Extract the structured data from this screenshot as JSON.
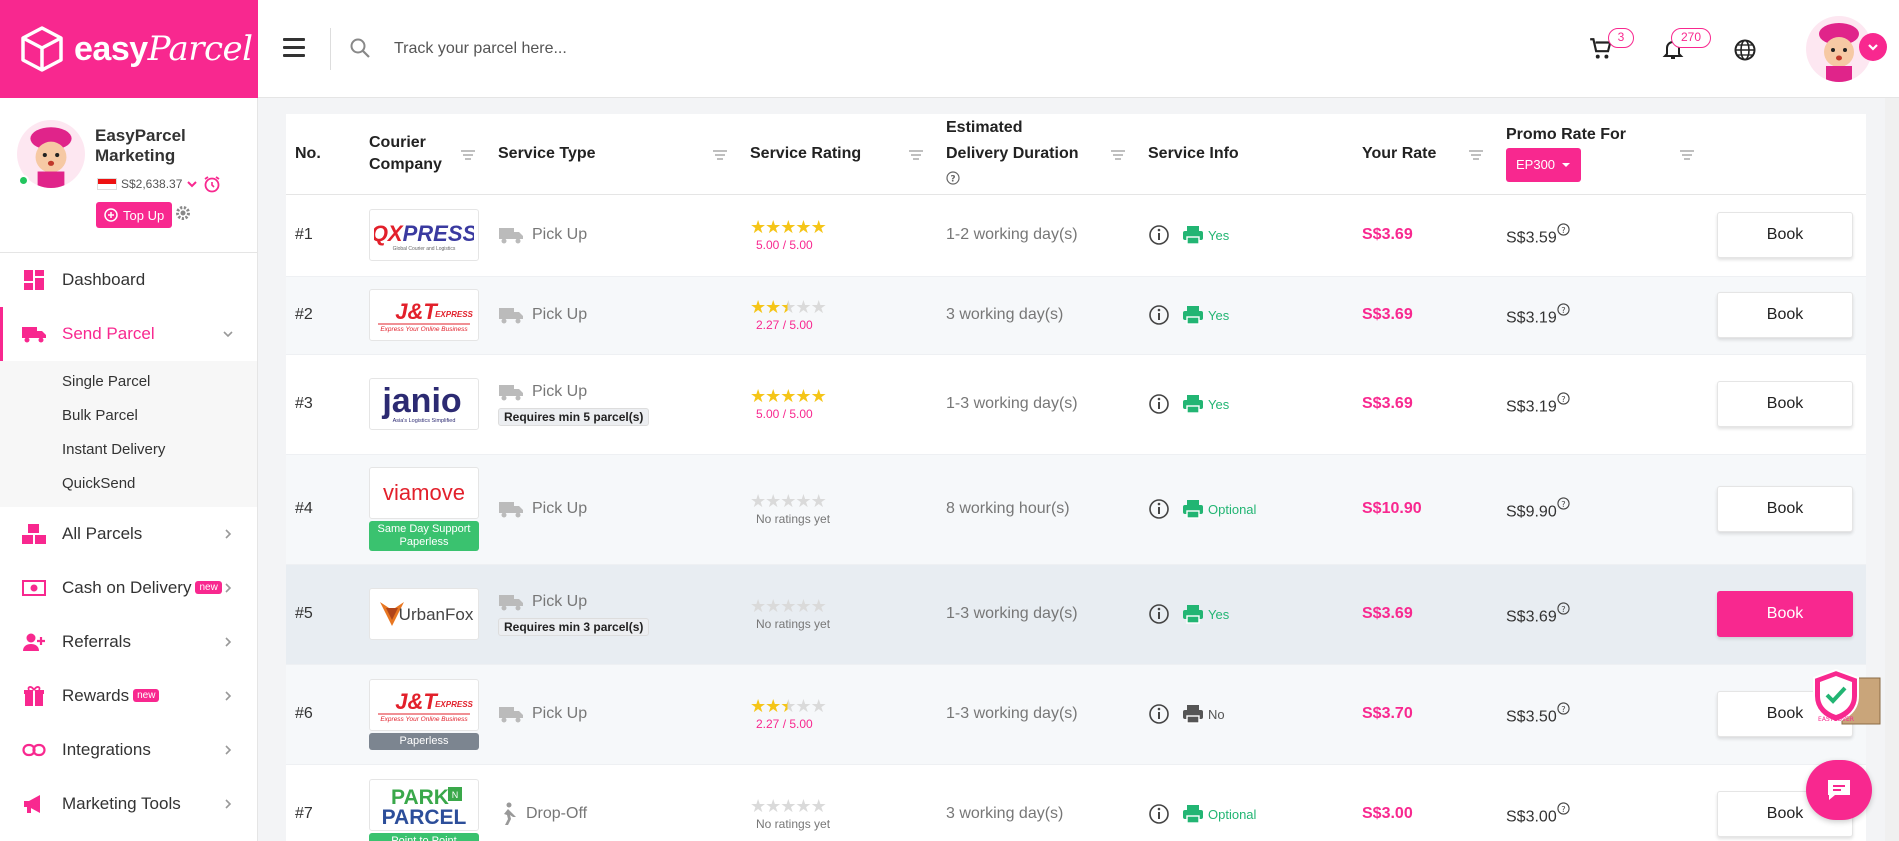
{
  "brand": {
    "name_bold": "easy",
    "name_script": "Parcel",
    "accent": "#f8288f"
  },
  "header": {
    "search_placeholder": "Track your parcel here...",
    "cart_count": "3",
    "notification_count": "270"
  },
  "profile": {
    "name": "EasyParcel Marketing",
    "balance": "S$2,638.37",
    "topup_label": "Top Up"
  },
  "sidebar": {
    "dashboard": "Dashboard",
    "send_parcel": "Send Parcel",
    "sub_items": [
      "Single Parcel",
      "Bulk Parcel",
      "Instant Delivery",
      "QuickSend"
    ],
    "all_parcels": "All Parcels",
    "cod": "Cash on Delivery",
    "referrals": "Referrals",
    "rewards": "Rewards",
    "integrations": "Integrations",
    "marketing_tools": "Marketing Tools",
    "new_label": "new"
  },
  "table": {
    "headers": {
      "no": "No.",
      "courier": "Courier Company",
      "service_type": "Service Type",
      "rating": "Service Rating",
      "duration": "Estimated Delivery Duration",
      "info": "Service Info",
      "your_rate": "Your Rate",
      "promo": "Promo Rate For",
      "promo_code": "EP300"
    },
    "book_label": "Book",
    "rows": [
      {
        "no": "#1",
        "courier": "QXPRESS",
        "tag": "",
        "service": "Pick Up",
        "req": "",
        "stars": 5,
        "rating": "5.00 / 5.00",
        "duration": "1-2 working day(s)",
        "print": "Yes",
        "rate": "S$3.69",
        "promo": "S$3.59"
      },
      {
        "no": "#2",
        "courier": "J&T EXPRESS",
        "tag": "",
        "service": "Pick Up",
        "req": "",
        "stars": 2.27,
        "rating": "2.27 / 5.00",
        "duration": "3 working day(s)",
        "print": "Yes",
        "rate": "S$3.69",
        "promo": "S$3.19"
      },
      {
        "no": "#3",
        "courier": "janio",
        "tag": "",
        "service": "Pick Up",
        "req": "Requires min 5 parcel(s)",
        "stars": 5,
        "rating": "5.00 / 5.00",
        "duration": "1-3 working day(s)",
        "print": "Yes",
        "rate": "S$3.69",
        "promo": "S$3.19"
      },
      {
        "no": "#4",
        "courier": "viamove",
        "tag": "Same Day Support Paperless",
        "service": "Pick Up",
        "req": "",
        "stars": 0,
        "rating": "No ratings yet",
        "duration": "8 working hour(s)",
        "print": "Optional",
        "rate": "S$10.90",
        "promo": "S$9.90"
      },
      {
        "no": "#5",
        "courier": "UrbanFox",
        "tag": "",
        "service": "Pick Up",
        "req": "Requires min 3 parcel(s)",
        "stars": 0,
        "rating": "No ratings yet",
        "duration": "1-3 working day(s)",
        "print": "Yes",
        "rate": "S$3.69",
        "promo": "S$3.69"
      },
      {
        "no": "#6",
        "courier": "J&T EXPRESS",
        "tag": "Paperless",
        "service": "Pick Up",
        "req": "",
        "stars": 2.27,
        "rating": "2.27 / 5.00",
        "duration": "1-3 working day(s)",
        "print": "No",
        "rate": "S$3.70",
        "promo": "S$3.50"
      },
      {
        "no": "#7",
        "courier": "PARK N PARCEL",
        "tag": "Point to Point",
        "service": "Drop-Off",
        "req": "",
        "stars": 0,
        "rating": "No ratings yet",
        "duration": "3 working day(s)",
        "print": "Optional",
        "rate": "S$3.00",
        "promo": "S$3.00"
      }
    ]
  },
  "widgets": {
    "easycover": "EASYCOVER"
  }
}
